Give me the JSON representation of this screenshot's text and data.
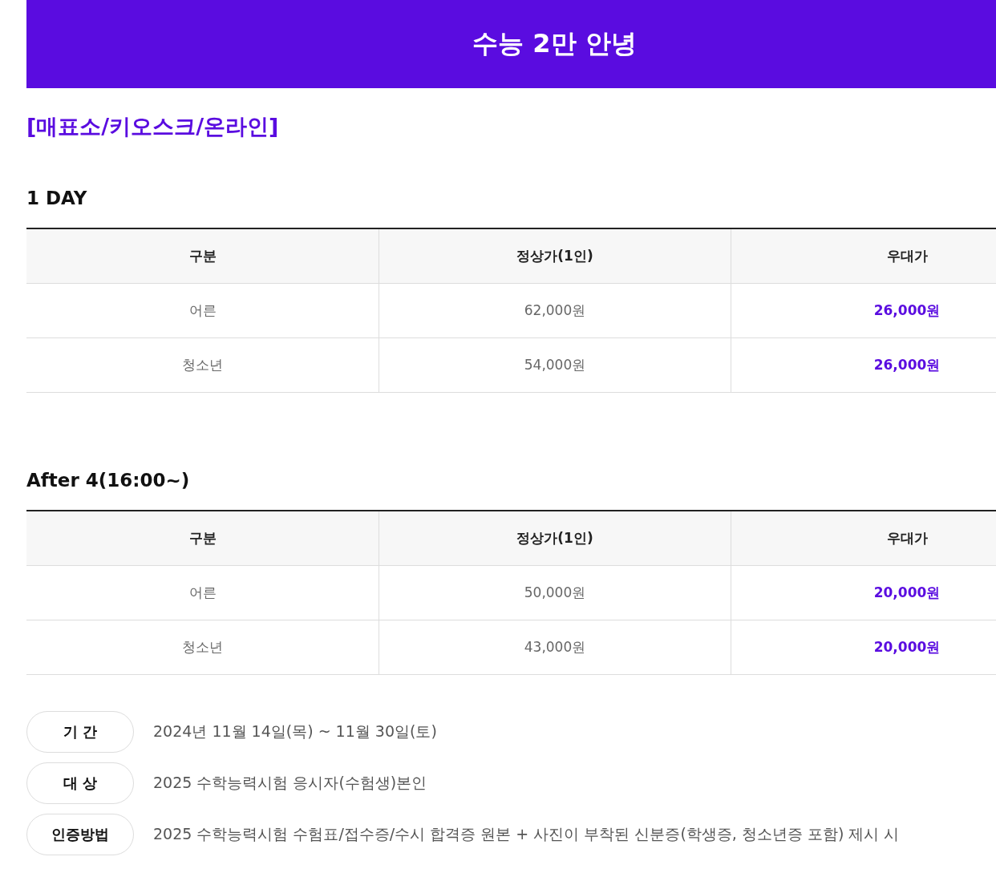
{
  "banner": {
    "title": "수능 2만 안녕"
  },
  "channel_heading": "[매표소/키오스크/온라인]",
  "sections": [
    {
      "title": "1 DAY",
      "columns": [
        "구분",
        "정상가(1인)",
        "우대가"
      ],
      "rows": [
        {
          "cells": [
            "어른",
            "62,000원",
            "26,000원"
          ]
        },
        {
          "cells": [
            "청소년",
            "54,000원",
            "26,000원"
          ]
        }
      ]
    },
    {
      "title": "After 4(16:00~)",
      "columns": [
        "구분",
        "정상가(1인)",
        "우대가"
      ],
      "rows": [
        {
          "cells": [
            "어른",
            "50,000원",
            "20,000원"
          ]
        },
        {
          "cells": [
            "청소년",
            "43,000원",
            "20,000원"
          ]
        }
      ]
    }
  ],
  "info": [
    {
      "label": "기 간",
      "text": "2024년 11월 14일(목) ~ 11월 30일(토)"
    },
    {
      "label": "대 상",
      "text": "2025 수학능력시험 응시자(수험생)본인"
    },
    {
      "label": "인증방법",
      "text": "2025 수학능력시험 수험표/접수증/수시 합격증 원본 + 사진이 부착된 신분증(학생증, 청소년증 포함) 제시 시"
    }
  ]
}
